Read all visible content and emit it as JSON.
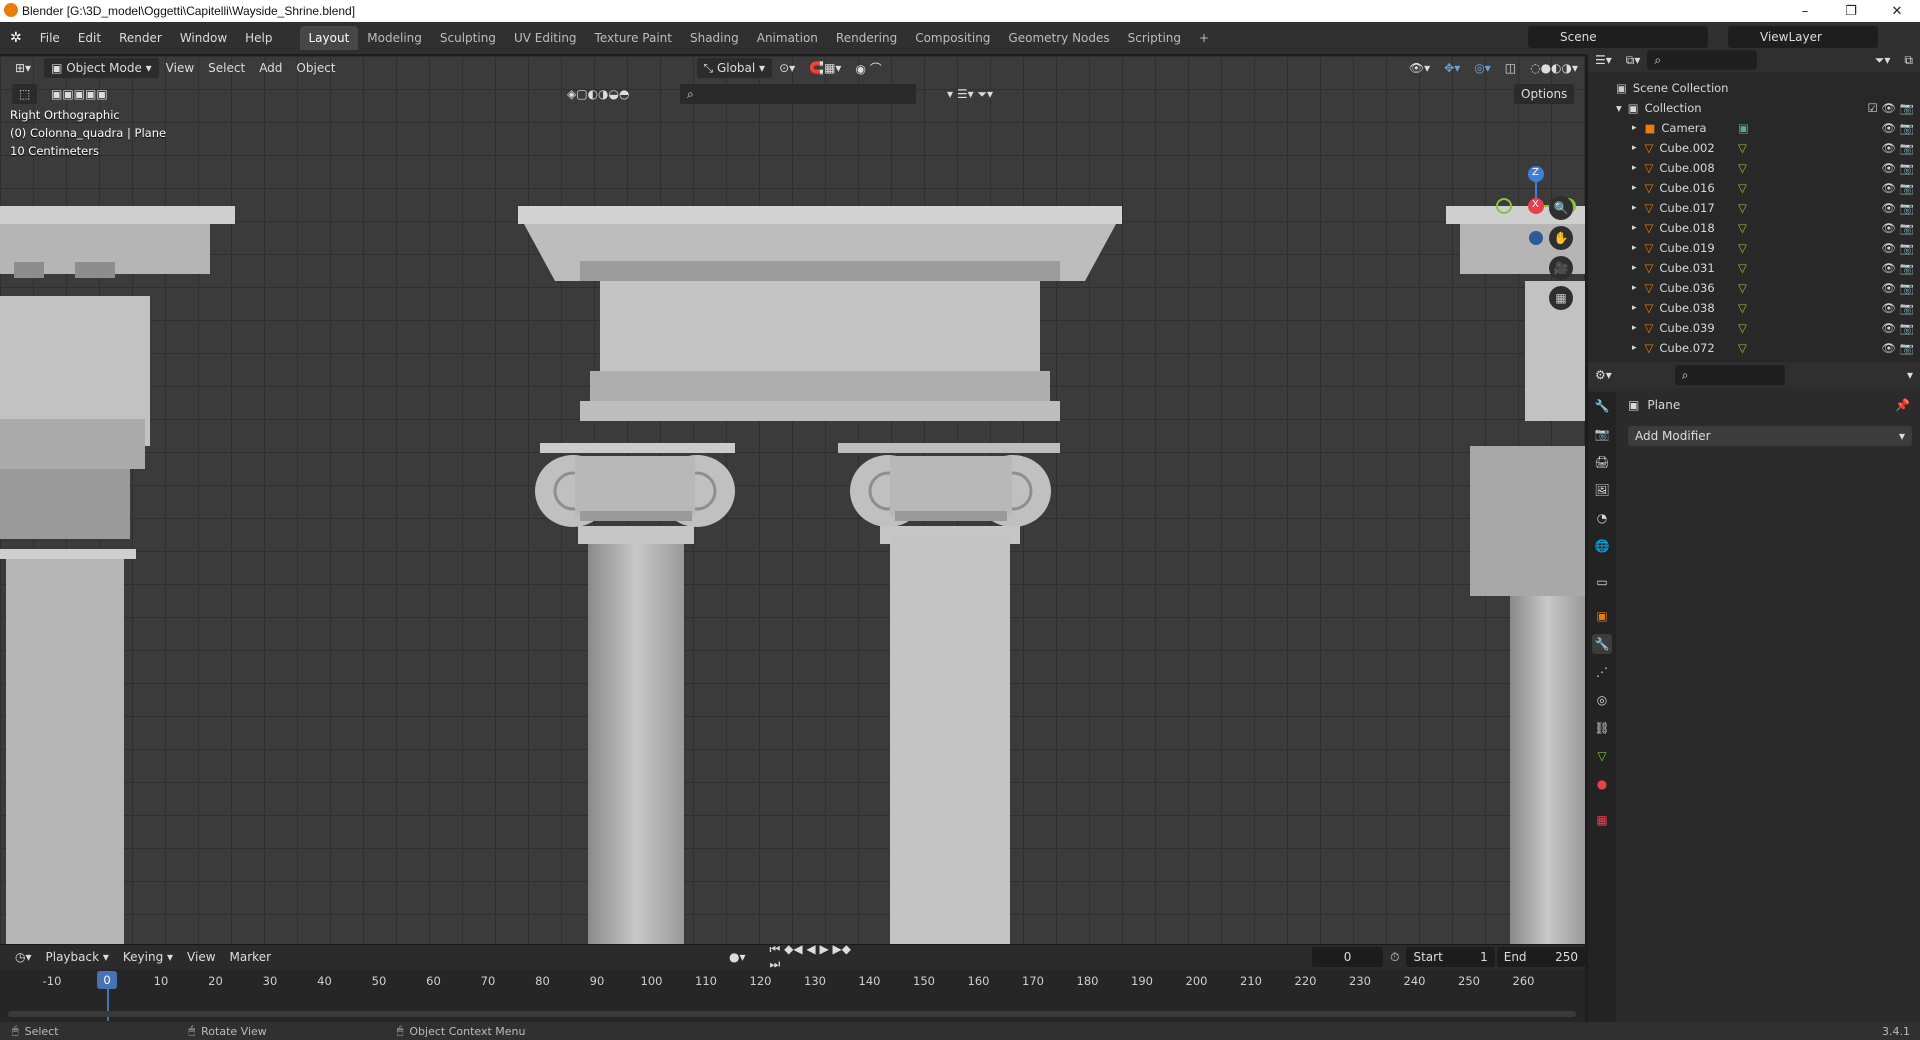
{
  "window": {
    "title": "Blender [G:\\3D_model\\Oggetti\\Capitelli\\Wayside_Shrine.blend]",
    "minimize": "–",
    "restore": "❐",
    "close": "✕"
  },
  "menu": [
    "File",
    "Edit",
    "Render",
    "Window",
    "Help"
  ],
  "workspaces": [
    "Layout",
    "Modeling",
    "Sculpting",
    "UV Editing",
    "Texture Paint",
    "Shading",
    "Animation",
    "Rendering",
    "Compositing",
    "Geometry Nodes",
    "Scripting",
    "+"
  ],
  "scene": "Scene",
  "view_layer": "ViewLayer",
  "viewport": {
    "mode": "Object Mode",
    "menu": [
      "View",
      "Select",
      "Add",
      "Object"
    ],
    "orientation": "Global",
    "options": "Options",
    "view_name": "Right Orthographic",
    "object_info": "(0) Colonna_quadra | Plane",
    "grid_scale": "10 Centimeters",
    "gizmo": {
      "x": "X",
      "y": "Y",
      "z": "Z"
    }
  },
  "outliner": {
    "root": "Scene Collection",
    "collection": "Collection",
    "items": [
      "Camera",
      "Cube.002",
      "Cube.008",
      "Cube.016",
      "Cube.017",
      "Cube.018",
      "Cube.019",
      "Cube.031",
      "Cube.036",
      "Cube.038",
      "Cube.039",
      "Cube.072"
    ]
  },
  "properties": {
    "object_name": "Plane",
    "add_modifier": "Add Modifier"
  },
  "timeline": {
    "menu": [
      "Playback",
      "Keying",
      "View",
      "Marker"
    ],
    "current_frame": "0",
    "start_label": "Start",
    "start": "1",
    "end_label": "End",
    "end": "250",
    "ruler": [
      "-10",
      "0",
      "10",
      "20",
      "30",
      "40",
      "50",
      "60",
      "70",
      "80",
      "90",
      "100",
      "110",
      "120",
      "130",
      "140",
      "150",
      "160",
      "170",
      "180",
      "190",
      "200",
      "210",
      "220",
      "230",
      "240",
      "250",
      "260"
    ],
    "playhead": "0"
  },
  "status": {
    "select": "Select",
    "rotate": "Rotate View",
    "context": "Object Context Menu",
    "version": "3.4.1"
  },
  "colors": {
    "accent": "#4772b3",
    "mesh_icon": "#e87d0d",
    "x_axis": "#e8404f",
    "y_axis": "#8ac23c",
    "z_axis": "#3f7fd8"
  }
}
